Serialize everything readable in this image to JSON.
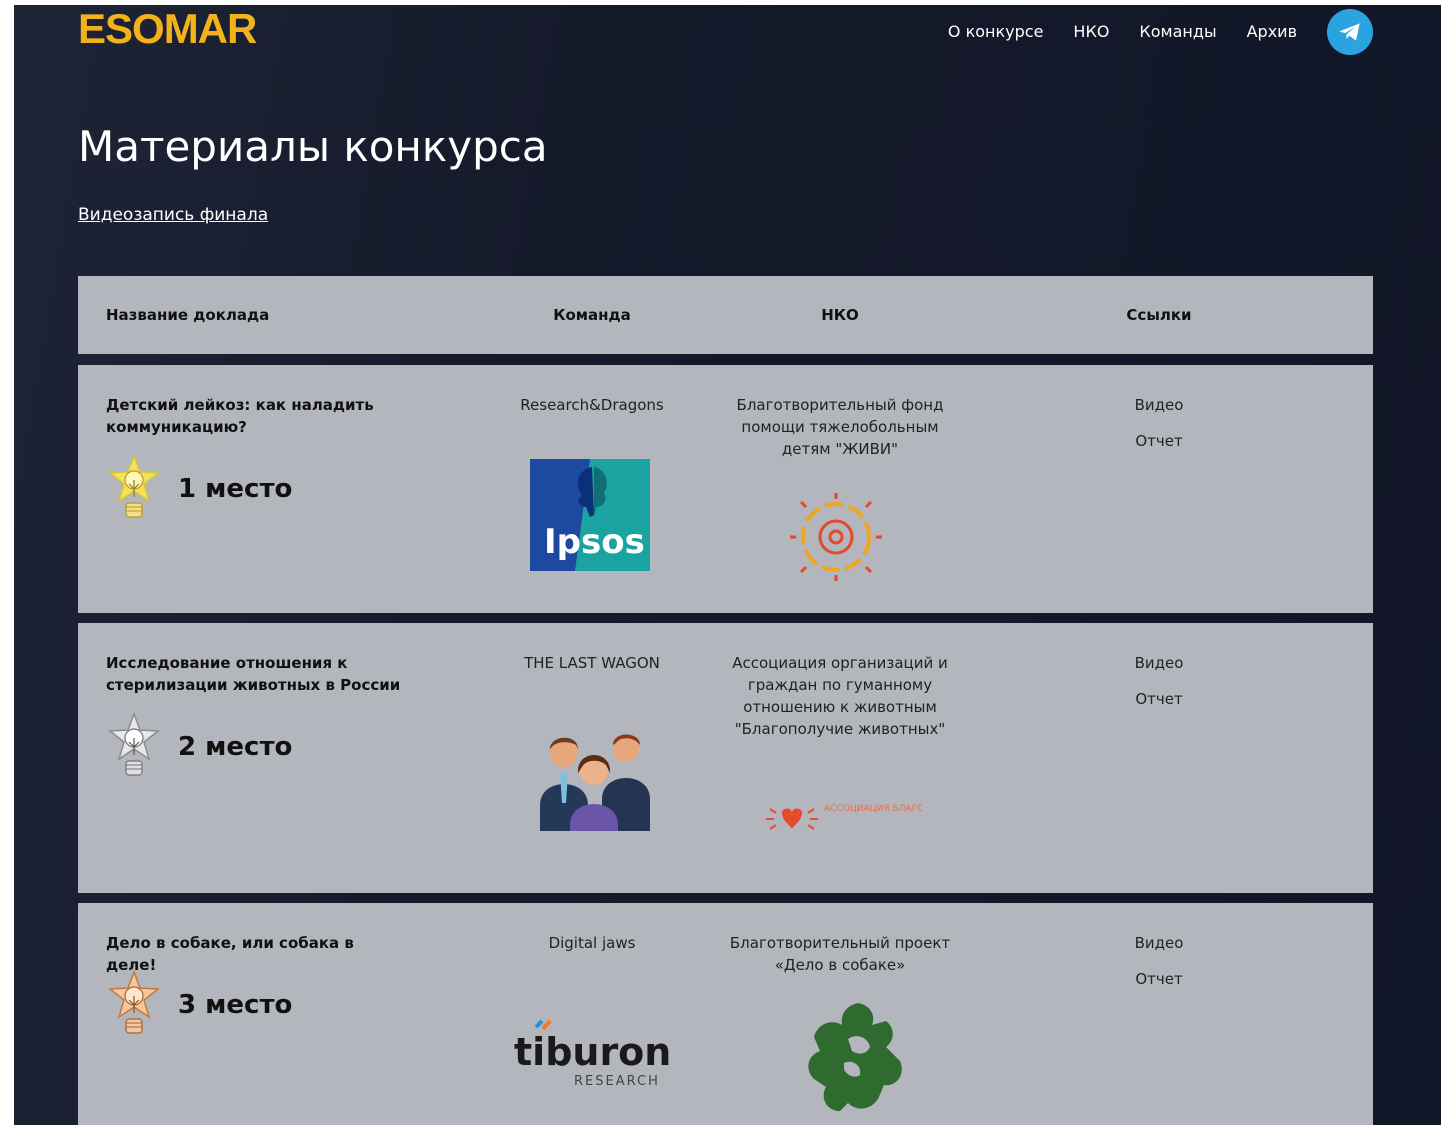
{
  "site": {
    "logo": "ESOMAR",
    "nav": [
      "О конкурсе",
      "НКО",
      "Команды",
      "Архив"
    ]
  },
  "page": {
    "title": "Материалы конкурса",
    "video_link": "Видеозапись финала"
  },
  "table": {
    "headers": [
      "Название доклада",
      "Команда",
      "НКО",
      "Ссылки"
    ],
    "rows": [
      {
        "title": "Детский лейкоз: как наладить коммуникацию?",
        "place": "1 место",
        "team": "Research&Dragons",
        "team_logo": "Ipsos",
        "nko": "Благотворительный фонд помощи тяжелобольным детям \"ЖИВИ\"",
        "links": [
          "Видео",
          "Отчет"
        ]
      },
      {
        "title": "Исследование отношения к стерилизации животных в России",
        "place": "2 место",
        "team": "THE LAST WAGON",
        "nko": "Ассоциация организаций и граждан по гуманному отношению к животным \"Благополучие животных\"",
        "nko_logo": "АССОЦИАЦИЯ БЛАГОПОЛУЧИЕ ЖИВОТНЫХ",
        "links": [
          "Видео",
          "Отчет"
        ]
      },
      {
        "title": "Дело в собаке, или собака в деле!",
        "place": "3 место",
        "team": "Digital jaws",
        "team_logo": "tiburon",
        "team_logo_sub": "RESEARCH",
        "nko": "Благотворительный проект «Дело в собаке»",
        "links": [
          "Видео",
          "Отчет"
        ]
      }
    ]
  },
  "colors": {
    "brand": "#f2b21a",
    "telegram": "#2aa3e0",
    "table_bg": "#b4b6bd",
    "page_bg": "#151a2b",
    "award_gold": "#f3e25a",
    "award_silver": "#e7e7ea",
    "award_bronze": "#f6c79e"
  },
  "icons": {
    "telegram": "telegram-icon",
    "award": "lightbulb-star-icon"
  }
}
